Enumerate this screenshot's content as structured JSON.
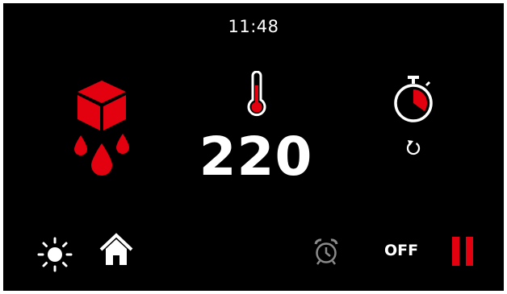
{
  "status_bar": {
    "time": "11:48"
  },
  "program": {
    "mode_icon": "defrost-icon"
  },
  "temperature": {
    "icon": "thermometer-icon",
    "value": "220"
  },
  "timer": {
    "icon": "stopwatch-icon",
    "reset_icon": "reset-icon",
    "progress": 0.35
  },
  "bottom_bar": {
    "brightness_icon": "brightness-icon",
    "home_icon": "home-icon",
    "alarm_icon": "alarm-clock-icon",
    "off_label": "OFF",
    "pause_icon": "pause-icon"
  },
  "colors": {
    "accent": "#e3000f",
    "background": "#000000",
    "text": "#ffffff",
    "muted": "#8a8a8a"
  }
}
